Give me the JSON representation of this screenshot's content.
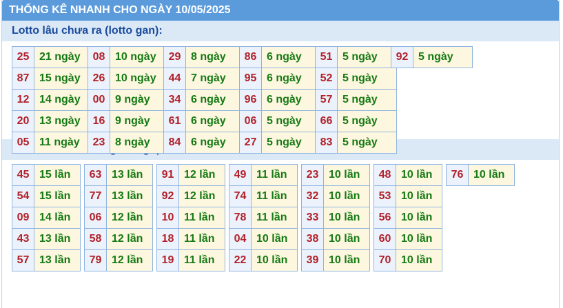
{
  "header": {
    "title": "THỐNG KÊ NHANH CHO NGÀY 10/05/2025"
  },
  "gan": {
    "title": "Lotto lâu chưa ra (lotto gan):",
    "columns": [
      [
        {
          "num": "25",
          "val": "21 ngày"
        },
        {
          "num": "87",
          "val": "15 ngày"
        },
        {
          "num": "12",
          "val": "14 ngày"
        },
        {
          "num": "20",
          "val": "13 ngày"
        },
        {
          "num": "05",
          "val": "11 ngày"
        }
      ],
      [
        {
          "num": "08",
          "val": "10 ngày"
        },
        {
          "num": "26",
          "val": "10 ngày"
        },
        {
          "num": "00",
          "val": "9 ngày"
        },
        {
          "num": "16",
          "val": "9 ngày"
        },
        {
          "num": "23",
          "val": "8 ngày"
        }
      ],
      [
        {
          "num": "29",
          "val": "8 ngày"
        },
        {
          "num": "44",
          "val": "7 ngày"
        },
        {
          "num": "34",
          "val": "6 ngày"
        },
        {
          "num": "61",
          "val": "6 ngày"
        },
        {
          "num": "84",
          "val": "6 ngày"
        }
      ],
      [
        {
          "num": "86",
          "val": "6 ngày"
        },
        {
          "num": "95",
          "val": "6 ngày"
        },
        {
          "num": "96",
          "val": "6 ngày"
        },
        {
          "num": "06",
          "val": "5 ngày"
        },
        {
          "num": "27",
          "val": "5 ngày"
        }
      ],
      [
        {
          "num": "51",
          "val": "5 ngày"
        },
        {
          "num": "52",
          "val": "5 ngày"
        },
        {
          "num": "57",
          "val": "5 ngày"
        },
        {
          "num": "66",
          "val": "5 ngày"
        },
        {
          "num": "83",
          "val": "5 ngày"
        }
      ],
      [
        {
          "num": "92",
          "val": "5 ngày"
        }
      ]
    ]
  },
  "freq": {
    "title": "Lotto ra nhiều trong tháng qua:",
    "columns": [
      [
        {
          "num": "45",
          "val": "15 lần"
        },
        {
          "num": "54",
          "val": "15 lần"
        },
        {
          "num": "09",
          "val": "14 lần"
        },
        {
          "num": "43",
          "val": "13 lần"
        },
        {
          "num": "57",
          "val": "13 lần"
        }
      ],
      [
        {
          "num": "63",
          "val": "13 lần"
        },
        {
          "num": "77",
          "val": "13 lần"
        },
        {
          "num": "06",
          "val": "12 lần"
        },
        {
          "num": "58",
          "val": "12 lần"
        },
        {
          "num": "79",
          "val": "12 lần"
        }
      ],
      [
        {
          "num": "91",
          "val": "12 lần"
        },
        {
          "num": "92",
          "val": "12 lần"
        },
        {
          "num": "10",
          "val": "11 lần"
        },
        {
          "num": "18",
          "val": "11 lần"
        },
        {
          "num": "19",
          "val": "11 lần"
        }
      ],
      [
        {
          "num": "49",
          "val": "11 lần"
        },
        {
          "num": "74",
          "val": "11 lần"
        },
        {
          "num": "78",
          "val": "11 lần"
        },
        {
          "num": "04",
          "val": "10 lần"
        },
        {
          "num": "22",
          "val": "10 lần"
        }
      ],
      [
        {
          "num": "23",
          "val": "10 lần"
        },
        {
          "num": "32",
          "val": "10 lần"
        },
        {
          "num": "33",
          "val": "10 lần"
        },
        {
          "num": "38",
          "val": "10 lần"
        },
        {
          "num": "39",
          "val": "10 lần"
        }
      ],
      [
        {
          "num": "48",
          "val": "10 lần"
        },
        {
          "num": "53",
          "val": "10 lần"
        },
        {
          "num": "56",
          "val": "10 lần"
        },
        {
          "num": "60",
          "val": "10 lần"
        },
        {
          "num": "70",
          "val": "10 lần"
        }
      ],
      [
        {
          "num": "76",
          "val": "10 lần"
        }
      ]
    ]
  }
}
